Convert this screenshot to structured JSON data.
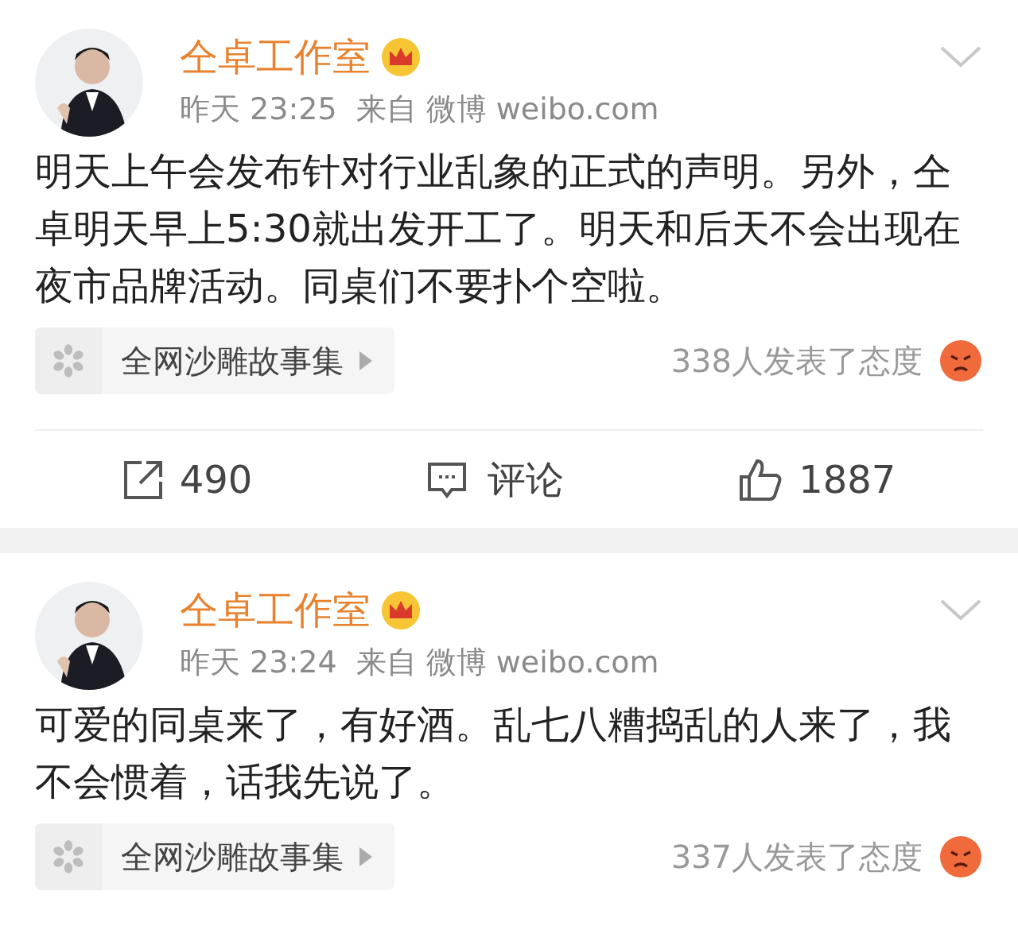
{
  "posts": [
    {
      "author": "仝卓工作室",
      "time": "昨天 23:25",
      "source_label": "来自",
      "source": "微博 weibo.com",
      "text": "明天上午会发布针对行业乱象的正式的声明。另外，仝卓明天早上5:30就出发开工了。明天和后天不会出现在夜市品牌活动。同桌们不要扑个空啦。",
      "topic": "全网沙雕故事集",
      "reactions": "338人发表了态度",
      "actions": {
        "repost": "490",
        "comment": "评论",
        "like": "1887"
      }
    },
    {
      "author": "仝卓工作室",
      "time": "昨天 23:24",
      "source_label": "来自",
      "source": "微博 weibo.com",
      "text": "可爱的同桌来了，有好酒。乱七八糟捣乱的人来了，我不会惯着，话我先说了。",
      "topic": "全网沙雕故事集",
      "reactions": "337人发表了态度"
    }
  ]
}
